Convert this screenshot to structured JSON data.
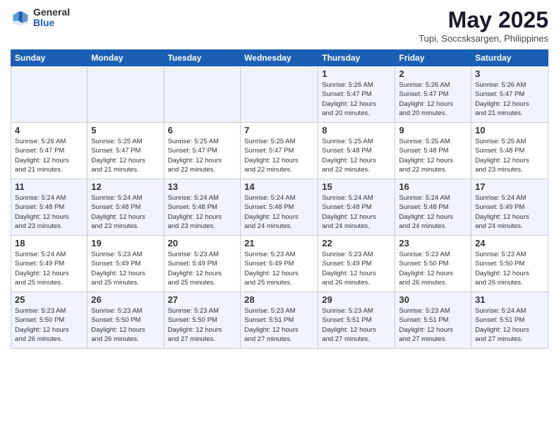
{
  "header": {
    "logo_general": "General",
    "logo_blue": "Blue",
    "month_title": "May 2025",
    "location": "Tupi, Soccsksargen, Philippines"
  },
  "weekdays": [
    "Sunday",
    "Monday",
    "Tuesday",
    "Wednesday",
    "Thursday",
    "Friday",
    "Saturday"
  ],
  "weeks": [
    [
      {
        "day": "",
        "info": ""
      },
      {
        "day": "",
        "info": ""
      },
      {
        "day": "",
        "info": ""
      },
      {
        "day": "",
        "info": ""
      },
      {
        "day": "1",
        "info": "Sunrise: 5:26 AM\nSunset: 5:47 PM\nDaylight: 12 hours\nand 20 minutes."
      },
      {
        "day": "2",
        "info": "Sunrise: 5:26 AM\nSunset: 5:47 PM\nDaylight: 12 hours\nand 20 minutes."
      },
      {
        "day": "3",
        "info": "Sunrise: 5:26 AM\nSunset: 5:47 PM\nDaylight: 12 hours\nand 21 minutes."
      }
    ],
    [
      {
        "day": "4",
        "info": "Sunrise: 5:26 AM\nSunset: 5:47 PM\nDaylight: 12 hours\nand 21 minutes."
      },
      {
        "day": "5",
        "info": "Sunrise: 5:25 AM\nSunset: 5:47 PM\nDaylight: 12 hours\nand 21 minutes."
      },
      {
        "day": "6",
        "info": "Sunrise: 5:25 AM\nSunset: 5:47 PM\nDaylight: 12 hours\nand 22 minutes."
      },
      {
        "day": "7",
        "info": "Sunrise: 5:25 AM\nSunset: 5:47 PM\nDaylight: 12 hours\nand 22 minutes."
      },
      {
        "day": "8",
        "info": "Sunrise: 5:25 AM\nSunset: 5:48 PM\nDaylight: 12 hours\nand 22 minutes."
      },
      {
        "day": "9",
        "info": "Sunrise: 5:25 AM\nSunset: 5:48 PM\nDaylight: 12 hours\nand 22 minutes."
      },
      {
        "day": "10",
        "info": "Sunrise: 5:25 AM\nSunset: 5:48 PM\nDaylight: 12 hours\nand 23 minutes."
      }
    ],
    [
      {
        "day": "11",
        "info": "Sunrise: 5:24 AM\nSunset: 5:48 PM\nDaylight: 12 hours\nand 23 minutes."
      },
      {
        "day": "12",
        "info": "Sunrise: 5:24 AM\nSunset: 5:48 PM\nDaylight: 12 hours\nand 23 minutes."
      },
      {
        "day": "13",
        "info": "Sunrise: 5:24 AM\nSunset: 5:48 PM\nDaylight: 12 hours\nand 23 minutes."
      },
      {
        "day": "14",
        "info": "Sunrise: 5:24 AM\nSunset: 5:48 PM\nDaylight: 12 hours\nand 24 minutes."
      },
      {
        "day": "15",
        "info": "Sunrise: 5:24 AM\nSunset: 5:48 PM\nDaylight: 12 hours\nand 24 minutes."
      },
      {
        "day": "16",
        "info": "Sunrise: 5:24 AM\nSunset: 5:48 PM\nDaylight: 12 hours\nand 24 minutes."
      },
      {
        "day": "17",
        "info": "Sunrise: 5:24 AM\nSunset: 5:49 PM\nDaylight: 12 hours\nand 24 minutes."
      }
    ],
    [
      {
        "day": "18",
        "info": "Sunrise: 5:24 AM\nSunset: 5:49 PM\nDaylight: 12 hours\nand 25 minutes."
      },
      {
        "day": "19",
        "info": "Sunrise: 5:23 AM\nSunset: 5:49 PM\nDaylight: 12 hours\nand 25 minutes."
      },
      {
        "day": "20",
        "info": "Sunrise: 5:23 AM\nSunset: 5:49 PM\nDaylight: 12 hours\nand 25 minutes."
      },
      {
        "day": "21",
        "info": "Sunrise: 5:23 AM\nSunset: 5:49 PM\nDaylight: 12 hours\nand 25 minutes."
      },
      {
        "day": "22",
        "info": "Sunrise: 5:23 AM\nSunset: 5:49 PM\nDaylight: 12 hours\nand 26 minutes."
      },
      {
        "day": "23",
        "info": "Sunrise: 5:23 AM\nSunset: 5:50 PM\nDaylight: 12 hours\nand 26 minutes."
      },
      {
        "day": "24",
        "info": "Sunrise: 5:23 AM\nSunset: 5:50 PM\nDaylight: 12 hours\nand 26 minutes."
      }
    ],
    [
      {
        "day": "25",
        "info": "Sunrise: 5:23 AM\nSunset: 5:50 PM\nDaylight: 12 hours\nand 26 minutes."
      },
      {
        "day": "26",
        "info": "Sunrise: 5:23 AM\nSunset: 5:50 PM\nDaylight: 12 hours\nand 26 minutes."
      },
      {
        "day": "27",
        "info": "Sunrise: 5:23 AM\nSunset: 5:50 PM\nDaylight: 12 hours\nand 27 minutes."
      },
      {
        "day": "28",
        "info": "Sunrise: 5:23 AM\nSunset: 5:51 PM\nDaylight: 12 hours\nand 27 minutes."
      },
      {
        "day": "29",
        "info": "Sunrise: 5:23 AM\nSunset: 5:51 PM\nDaylight: 12 hours\nand 27 minutes."
      },
      {
        "day": "30",
        "info": "Sunrise: 5:23 AM\nSunset: 5:51 PM\nDaylight: 12 hours\nand 27 minutes."
      },
      {
        "day": "31",
        "info": "Sunrise: 5:24 AM\nSunset: 5:51 PM\nDaylight: 12 hours\nand 27 minutes."
      }
    ]
  ]
}
